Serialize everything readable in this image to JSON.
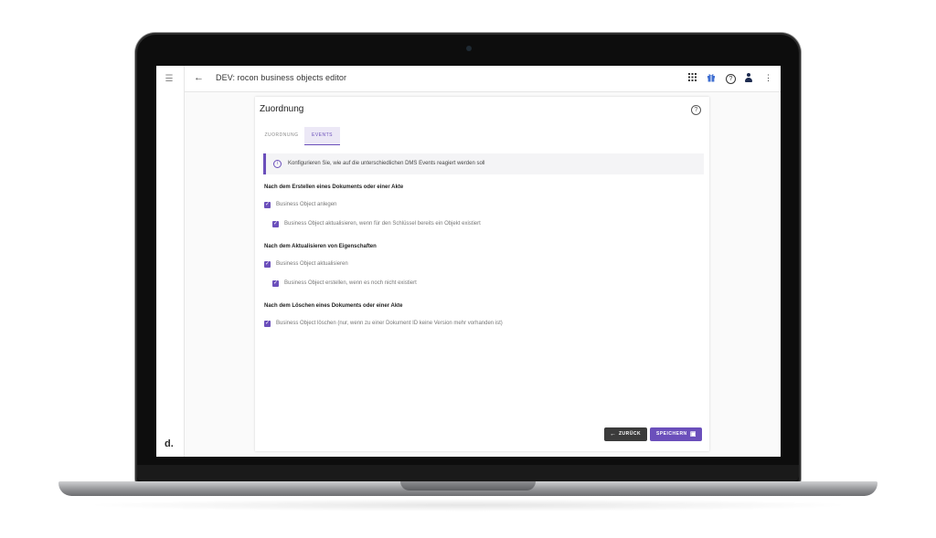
{
  "app": {
    "title": "DEV: rocon business objects editor",
    "logo": "d."
  },
  "icons": {
    "menu": "☰",
    "back": "←",
    "apps": "⋮⋮⋮",
    "gift": "✚",
    "help": "?",
    "more": "⋮",
    "info": "i",
    "check": "✓",
    "save": "▣"
  },
  "card": {
    "title": "Zuordnung",
    "tabs": [
      {
        "label": "ZUORDNUNG",
        "active": false
      },
      {
        "label": "EVENTS",
        "active": true
      }
    ],
    "info": "Konfigurieren Sie, wie auf die unterschiedlichen DMS Events reagiert werden soll",
    "sections": [
      {
        "heading": "Nach dem Erstellen eines Dokuments oder einer Akte",
        "options": [
          {
            "label": "Business Object anlegen",
            "checked": true
          },
          {
            "label": "Business Object aktualisieren, wenn für den Schlüssel bereits ein Objekt existiert",
            "checked": true
          }
        ]
      },
      {
        "heading": "Nach dem Aktualisieren von Eigenschaften",
        "options": [
          {
            "label": "Business Object aktualisieren",
            "checked": true
          },
          {
            "label": "Business Object erstellen, wenn es noch nicht existiert",
            "checked": true
          }
        ]
      },
      {
        "heading": "Nach dem Löschen eines Dokuments oder einer Akte",
        "options": [
          {
            "label": "Business Object löschen (nur, wenn zu einer Dokument ID keine Version mehr vorhanden ist)",
            "checked": true
          }
        ]
      }
    ],
    "buttons": {
      "back": "ZURÜCK",
      "save": "SPEICHERN"
    }
  },
  "colors": {
    "accent": "#6b4fbb",
    "dark_button": "#3b3b3b",
    "info_bg": "#f4f4f6"
  }
}
